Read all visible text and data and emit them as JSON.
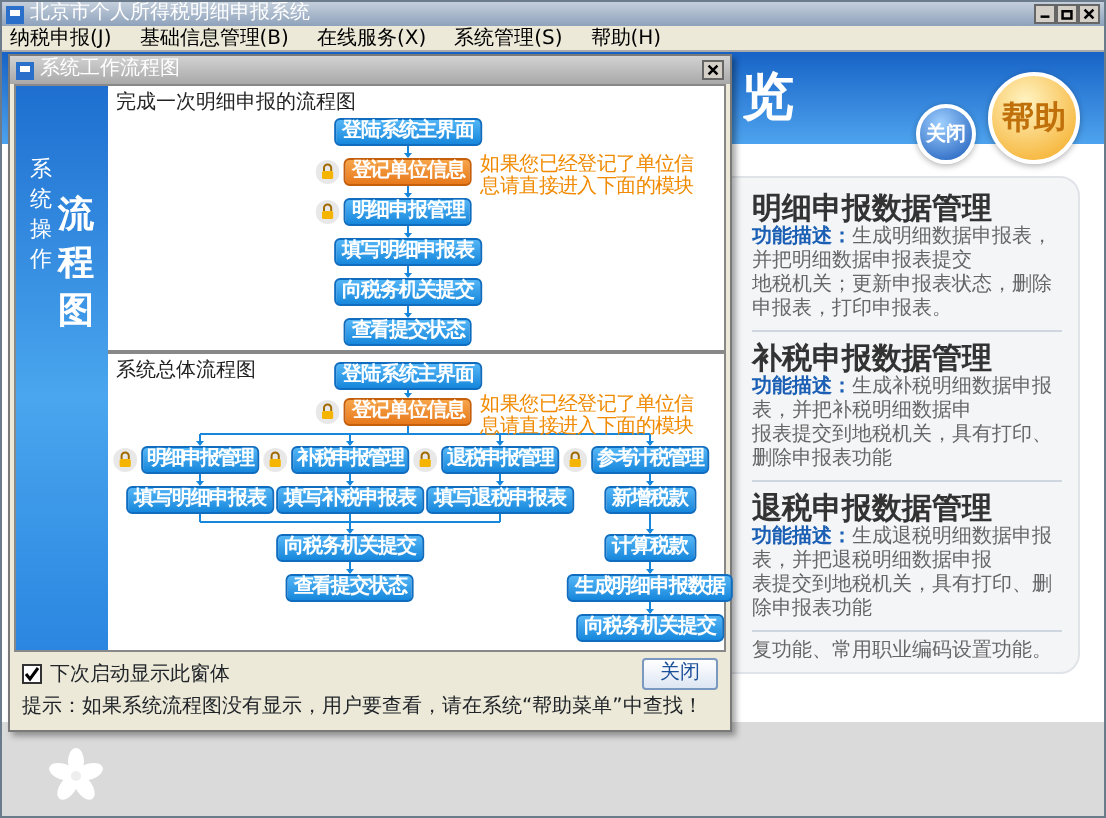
{
  "window": {
    "title": "北京市个人所得税明细申报系统"
  },
  "menu": [
    {
      "label": "纳税申报(J)"
    },
    {
      "label": "基础信息管理(B)"
    },
    {
      "label": "在线服务(X)"
    },
    {
      "label": "系统管理(S)"
    },
    {
      "label": "帮助(H)"
    }
  ],
  "main": {
    "heading": "览",
    "buttons": [
      {
        "label": "关闭",
        "kind": "close"
      },
      {
        "label": "帮助",
        "kind": "help"
      }
    ],
    "sections": [
      {
        "title": "明细申报数据管理",
        "lines": [
          "**功能描述：**生成明细数据申报表，并把明细数据申报表提交",
          "地税机关；更新申报表状态，删除申报表，打印申报表。"
        ]
      },
      {
        "title": "补税申报数据管理",
        "lines": [
          "**功能描述：**生成补税明细数据申报表，并把补税明细数据申",
          "报表提交到地税机关，具有打印、删除申报表功能"
        ]
      },
      {
        "title": "退税申报数据管理",
        "lines": [
          "**功能描述：**生成退税明细数据申报表，并把退税明细数据申报",
          "表提交到地税机关，具有打印、删除申报表功能"
        ]
      }
    ],
    "footer_line": "复功能、常用职业编码设置功能。"
  },
  "dialog": {
    "title": "系统工作流程图",
    "side_caption": "系统操作",
    "side_title": "流程图",
    "single_flow": {
      "label": "完成一次明细申报的流程图",
      "note": "如果您已经登记了单位信息请直接进入下面的模块",
      "steps": [
        {
          "label": "登陆系统主界面",
          "kind": "plain"
        },
        {
          "label": "登记单位信息",
          "kind": "register"
        },
        {
          "label": "明细申报管理",
          "kind": "module"
        },
        {
          "label": "填写明细申报表",
          "kind": "plain"
        },
        {
          "label": "向税务机关提交",
          "kind": "plain"
        },
        {
          "label": "查看提交状态",
          "kind": "plain"
        }
      ]
    },
    "overall_flow": {
      "label": "系统总体流程图",
      "note": "如果您已经登记了单位信息请直接进入下面的模块",
      "start": {
        "label": "登陆系统主界面",
        "kind": "plain"
      },
      "register": {
        "label": "登记单位信息",
        "kind": "register"
      },
      "branches": [
        {
          "manage": "明细申报管理",
          "steps": [
            "填写明细申报表"
          ]
        },
        {
          "manage": "补税申报管理",
          "steps": [
            "填写补税申报表"
          ]
        },
        {
          "manage": "退税申报管理",
          "steps": [
            "填写退税申报表"
          ]
        },
        {
          "manage": "参考计税管理",
          "steps": [
            "新增税款",
            "计算税款",
            "生成明细申报数据",
            "向税务机关提交"
          ]
        }
      ],
      "merged_steps": [
        "向税务机关提交",
        "查看提交状态"
      ]
    },
    "show_on_startup": {
      "label": "下次启动显示此窗体",
      "checked": true
    },
    "hint": "提示：如果系统流程图没有显示，用户要查看，请在系统“帮助菜单”中查找！",
    "close_button": "关闭"
  }
}
